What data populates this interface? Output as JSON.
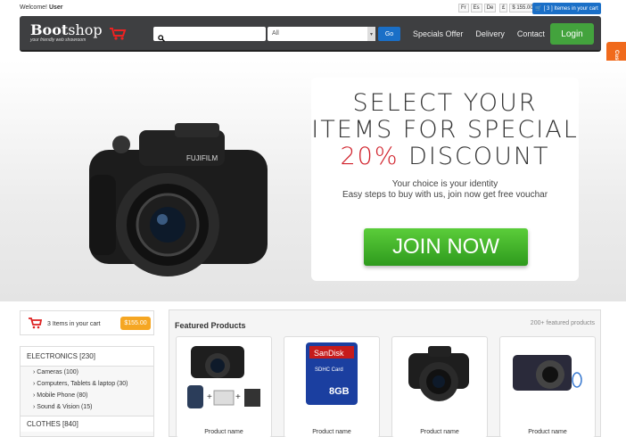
{
  "topbar": {
    "welcome_prefix": "Welcome!",
    "welcome_user": "User",
    "lang": [
      "Fr",
      "Es",
      "De"
    ],
    "currency": [
      "£",
      "$ 155.00",
      "$"
    ],
    "cart_label": "[ 3 ] Itemes in your cart"
  },
  "navbar": {
    "logo_main": "Boot",
    "logo_rest": "shop",
    "tagline": "your friendly web showroom",
    "search_placeholder": "",
    "select_value": "All",
    "go_label": "Go",
    "links": [
      "Specials Offer",
      "Delivery",
      "Contact"
    ],
    "login_label": "Login"
  },
  "customize": "Customize",
  "banner": {
    "line1": "SELECT YOUR",
    "line2": "ITEMS FOR SPECIAL",
    "line3_red": "20%",
    "line3_rest": " DISCOUNT",
    "sub1": "Your choice is your identity",
    "sub2": "Easy steps to buy with us, join now get free vouchar",
    "join_label": "JOIN NOW"
  },
  "sidebar": {
    "cart_text": "3 Items in your cart",
    "cart_price": "$155.00",
    "cat1": "ELECTRONICS [230]",
    "items": [
      "Cameras (100)",
      "Computers, Tablets & laptop (30)",
      "Mobile Phone (80)",
      "Sound & Vision (15)"
    ],
    "cat2": "CLOTHES [840]"
  },
  "featured": {
    "title": "Featured Products",
    "count": "200+ featured products",
    "products": [
      {
        "name": "Product name"
      },
      {
        "name": "Product name"
      },
      {
        "name": "Product name"
      },
      {
        "name": "Product name"
      }
    ]
  },
  "colors": {
    "navbar": "#3e3f41",
    "accent_blue": "#1a6fc7",
    "login_green": "#43a33d",
    "orange": "#f06a1c",
    "discount_red": "#d0202a"
  }
}
